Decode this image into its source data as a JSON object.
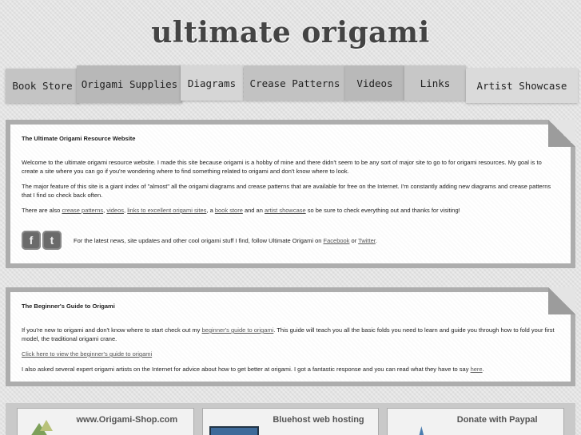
{
  "header": {
    "title": "ultimate origami"
  },
  "nav": {
    "tabs": [
      {
        "label": "Book Store"
      },
      {
        "label": "Origami Supplies"
      },
      {
        "label": "Diagrams"
      },
      {
        "label": "Crease Patterns"
      },
      {
        "label": "Videos"
      },
      {
        "label": "Links"
      },
      {
        "label": "Artist Showcase"
      }
    ]
  },
  "intro": {
    "heading": "The Ultimate Origami Resource Website",
    "p1": "Welcome to the ultimate origami resource website. I made this site because origami is a hobby of mine and there didn't seem to be any sort of major site to go to for origami resources. My goal is to create a site where you can go if you're wondering where to find something related to origami and don't know where to look.",
    "p2": "The major feature of this site is a giant index of \"almost\" all the origami diagrams and crease patterns that are available for free on the Internet. I'm constantly adding new diagrams and crease patterns that I find so check back often.",
    "p3_start": "There are also ",
    "p3_link1": "crease patterns",
    "p3_sep1": ", ",
    "p3_link2": "videos",
    "p3_sep2": ", ",
    "p3_link3": "links to excellent origami sites",
    "p3_sep3": ", a ",
    "p3_link4": "book store",
    "p3_sep4": " and an ",
    "p3_link5": "artist showcase",
    "p3_end": " so be sure to check everything out and thanks for visiting!",
    "social_start": "For the latest news, site updates and other cool origami stuff I find, follow Ultimate Origami on ",
    "social_link1": "Facebook",
    "social_mid": " or ",
    "social_link2": "Twitter",
    "social_end": ".",
    "facebook_glyph": "f",
    "twitter_glyph": "t"
  },
  "beginner": {
    "heading": "The Beginner's Guide to Origami",
    "p1_start": "If you're new to origami and don't know where to start check out my ",
    "p1_link": "beginner's guide to origami",
    "p1_end": ". This guide will teach you all the basic folds you need to learn and guide you through how to fold your first model, the traditional origami crane.",
    "cta_link": "Click here to view the beginner's guide to origami",
    "p2_start": "I also asked several expert origami artists on the Internet for advice about how to get better at origami. I got a fantastic response and you can read what they have to say ",
    "p2_link": "here",
    "p2_end": "."
  },
  "footer": {
    "ads": [
      {
        "label": "www.Origami-Shop.com"
      },
      {
        "label": "Bluehost web hosting"
      },
      {
        "label": "Donate with Paypal"
      }
    ]
  }
}
